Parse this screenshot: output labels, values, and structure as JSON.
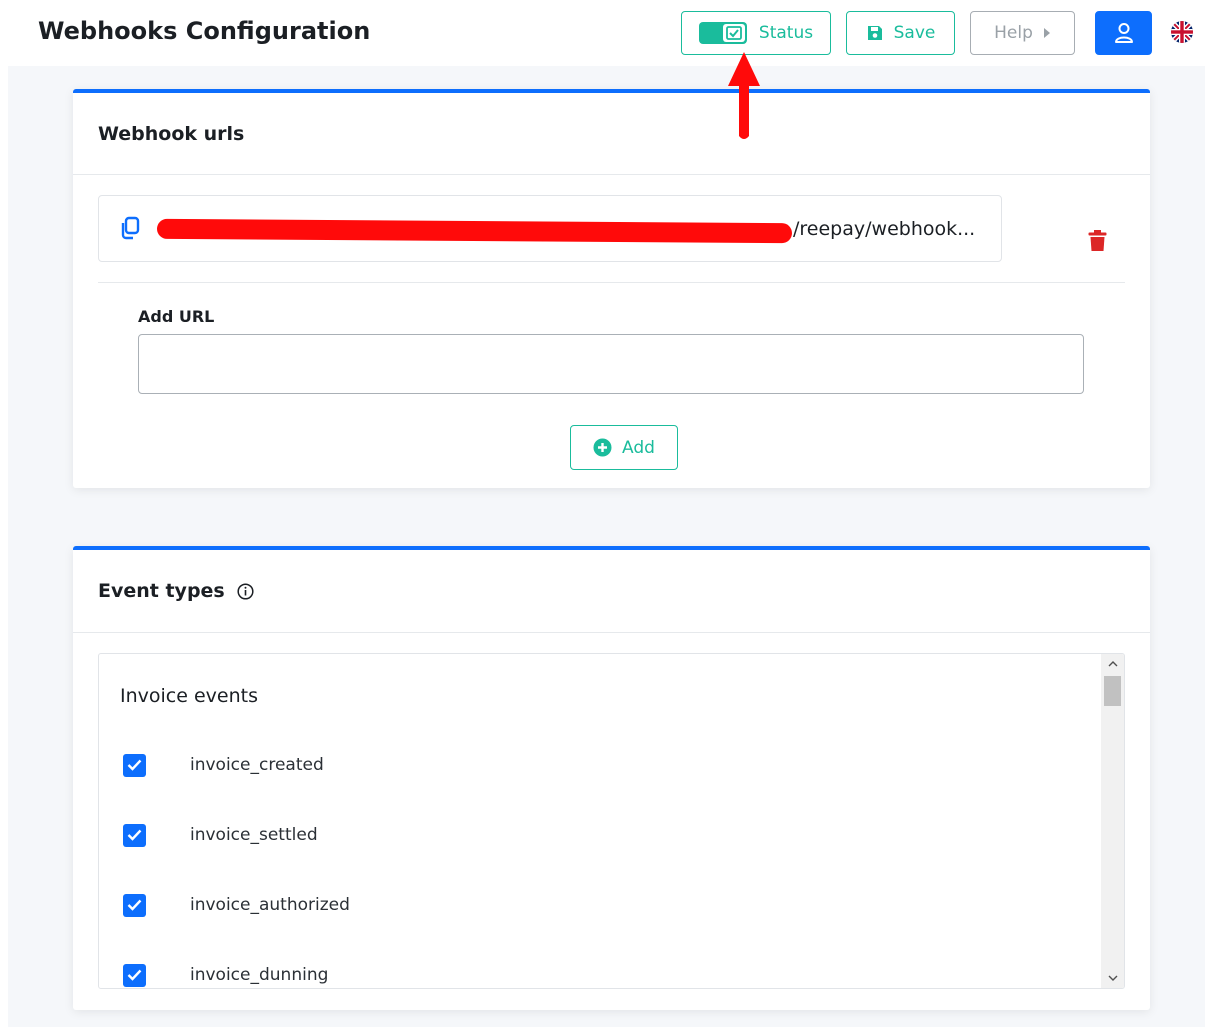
{
  "header": {
    "title": "Webhooks Configuration",
    "status_label": "Status",
    "save_label": "Save",
    "help_label": "Help"
  },
  "webhook_urls": {
    "title": "Webhook urls",
    "url_visible_suffix": "/reepay/webhook...",
    "add_url_label": "Add URL",
    "add_url_value": "",
    "add_button_label": "Add"
  },
  "event_types": {
    "title": "Event types",
    "groups": [
      {
        "name": "Invoice events",
        "events": [
          {
            "label": "invoice_created",
            "checked": true
          },
          {
            "label": "invoice_settled",
            "checked": true
          },
          {
            "label": "invoice_authorized",
            "checked": true
          },
          {
            "label": "invoice_dunning",
            "checked": true
          }
        ]
      }
    ]
  },
  "icons": {
    "status_toggle": "toggle-check-icon",
    "save": "floppy-disk-icon",
    "help": "caret-right-icon",
    "user": "user-icon",
    "language": "uk-flag-icon",
    "copy": "copy-icon",
    "delete": "trash-icon",
    "add": "plus-circle-icon",
    "info": "info-circle-icon"
  },
  "colors": {
    "primary": "#0d6efd",
    "accent": "#1abc9c",
    "danger": "#dc2626",
    "annotation": "#ff0a0a"
  }
}
